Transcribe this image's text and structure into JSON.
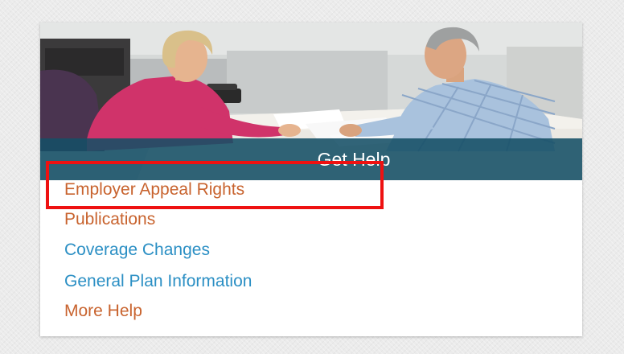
{
  "card": {
    "banner_title": "Get Help",
    "links": [
      {
        "label": "Employer Appeal Rights",
        "color": "#c8632e",
        "highlighted": true
      },
      {
        "label": "Publications",
        "color": "#c8632e",
        "highlighted": false
      },
      {
        "label": "Coverage Changes",
        "color": "#2b8fc4",
        "highlighted": false
      },
      {
        "label": "General Plan Information",
        "color": "#2b8fc4",
        "highlighted": false
      },
      {
        "label": "More Help",
        "color": "#c8632e",
        "highlighted": false
      }
    ]
  },
  "colors": {
    "banner": "#144e65",
    "highlight": "#ee1111",
    "link_orange": "#c8632e",
    "link_blue": "#2b8fc4"
  },
  "hero_image": {
    "icon": "photo-two-people-at-desk"
  }
}
